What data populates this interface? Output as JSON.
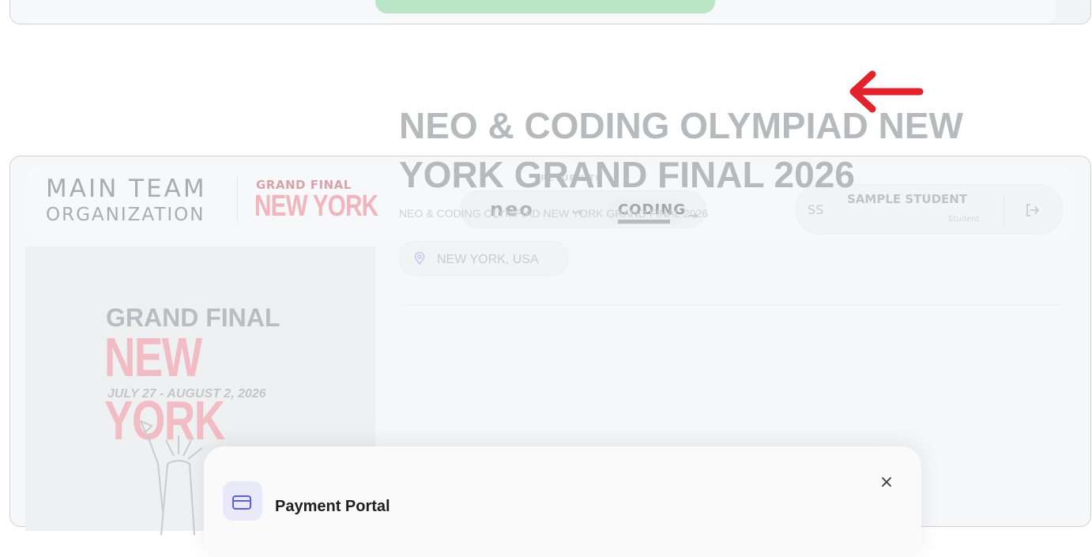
{
  "colors": {
    "accent_red": "#e3232b",
    "pill_green": "#b9e6c6",
    "brand_pink": "#f0b5bd",
    "modal_icon_bg": "#e9e9f9",
    "modal_icon": "#5b5ee0"
  },
  "top_card": {
    "button_label": ""
  },
  "header": {
    "org_line1": "MAIN TEAM",
    "org_line2": "ORGANIZATION",
    "event_badge_top": "GRAND FINAL",
    "event_badge_city": "NEW YORK",
    "return_label": "RETURN TO",
    "return_neo": "neo",
    "return_coding": "CODING",
    "user_initials": "SS",
    "user_name": "SAMPLE STUDENT",
    "user_role": "Student"
  },
  "banner": {
    "grand_final": "GRAND FINAL",
    "city": "NEW YORK",
    "dates": "JULY 27 - AUGUST 2, 2026"
  },
  "event": {
    "title": "NEO & CODING OLYMPIAD NEW YORK GRAND FINAL 2026",
    "subtitle": "NEO & CODING OLYMPIAD NEW YORK GRAND FINAL 2026",
    "location": "NEW YORK, USA"
  },
  "modal": {
    "title": "Payment Portal",
    "close_glyph": "×"
  }
}
